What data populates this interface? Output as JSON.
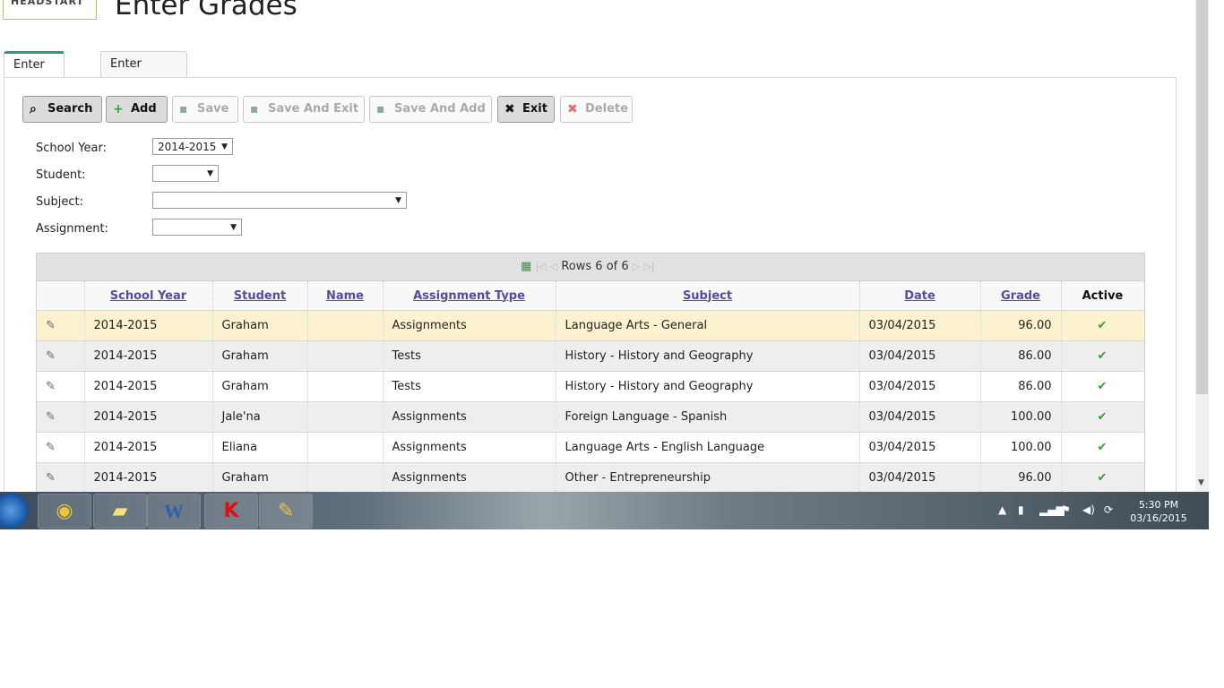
{
  "header": {
    "logo_text": "HEADSTART",
    "title": "Enter Grades"
  },
  "tabs": [
    {
      "label": "Enter Grades",
      "active": true
    },
    {
      "label": "Enter Attendance",
      "active": false
    }
  ],
  "toolbar": {
    "search": "Search",
    "add": "Add",
    "save": "Save",
    "save_and_exit": "Save And Exit",
    "save_and_add": "Save And Add",
    "exit": "Exit",
    "delete": "Delete"
  },
  "form": {
    "school_year_label": "School Year:",
    "school_year_value": "2014-2015",
    "student_label": "Student:",
    "student_value": "",
    "subject_label": "Subject:",
    "subject_value": "",
    "assignment_label": "Assignment:",
    "assignment_value": ""
  },
  "grid": {
    "pager_text": "Rows 6 of 6",
    "columns": [
      "School Year",
      "Student",
      "Name",
      "Assignment Type",
      "Subject",
      "Date",
      "Grade",
      "Active"
    ],
    "rows": [
      {
        "school_year": "2014-2015",
        "student": "Graham",
        "name": "",
        "assignment_type": "Assignments",
        "subject": "Language Arts - General",
        "date": "03/04/2015",
        "grade": "96.00",
        "active": true
      },
      {
        "school_year": "2014-2015",
        "student": "Graham",
        "name": "",
        "assignment_type": "Tests",
        "subject": "History - History and Geography",
        "date": "03/04/2015",
        "grade": "86.00",
        "active": true
      },
      {
        "school_year": "2014-2015",
        "student": "Graham",
        "name": "",
        "assignment_type": "Tests",
        "subject": "History - History and Geography",
        "date": "03/04/2015",
        "grade": "86.00",
        "active": true
      },
      {
        "school_year": "2014-2015",
        "student": "Jale'na",
        "name": "",
        "assignment_type": "Assignments",
        "subject": "Foreign Language - Spanish",
        "date": "03/04/2015",
        "grade": "100.00",
        "active": true
      },
      {
        "school_year": "2014-2015",
        "student": "Eliana",
        "name": "",
        "assignment_type": "Assignments",
        "subject": "Language Arts - English Language",
        "date": "03/04/2015",
        "grade": "100.00",
        "active": true
      },
      {
        "school_year": "2014-2015",
        "student": "Graham",
        "name": "",
        "assignment_type": "Assignments",
        "subject": "Other - Entrepreneurship",
        "date": "03/04/2015",
        "grade": "96.00",
        "active": true
      }
    ]
  },
  "taskbar": {
    "apps": [
      "chrome-icon",
      "notes-icon",
      "word-icon",
      "kaspersky-icon",
      "paint-icon"
    ],
    "time": "5:30 PM",
    "date": "03/16/2015"
  }
}
